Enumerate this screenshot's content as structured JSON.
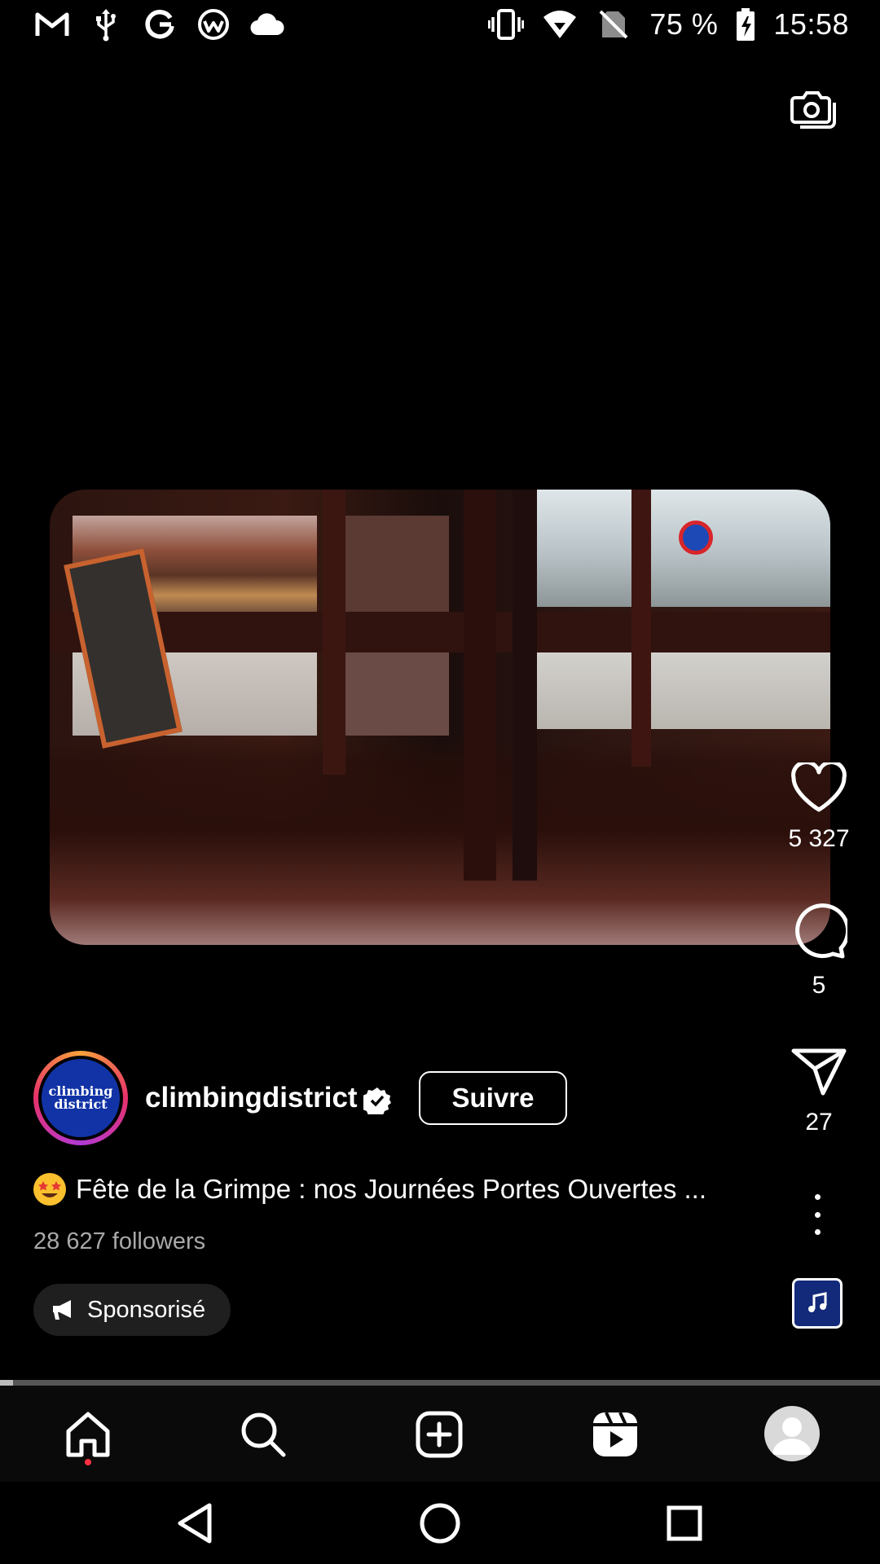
{
  "status_bar": {
    "left_icons": [
      "gmail-icon",
      "usb-icon",
      "google-icon",
      "app-icon",
      "cloud-icon"
    ],
    "right_icons": [
      "vibrate-icon",
      "wifi-icon",
      "no-sim-icon",
      "battery-charging-icon"
    ],
    "battery": "75 %",
    "time": "15:58"
  },
  "top_actions": {
    "camera_icon": "camera-icon"
  },
  "post": {
    "likes": "5 327",
    "comments": "5",
    "shares": "27",
    "progress": 0.015
  },
  "account": {
    "avatar_text_line1": "climbing",
    "avatar_text_line2": "district",
    "username": "climbingdistrict",
    "verified": true,
    "follow_label": "Suivre",
    "followers": "28 627 followers"
  },
  "caption": {
    "emoji": "star-struck-emoji",
    "text": "Fête de la Grimpe : nos Journées Portes Ouvertes ..."
  },
  "sponsored_label": "Sponsorisé",
  "bottom_nav": {
    "items": [
      "home-icon",
      "search-icon",
      "create-icon",
      "reels-icon",
      "profile-icon"
    ]
  },
  "system_nav": [
    "back-icon",
    "home-circle-icon",
    "recents-icon"
  ],
  "colors": {
    "background": "#000000",
    "avatar_blue": "#1233a6",
    "notification": "#ff3040"
  }
}
